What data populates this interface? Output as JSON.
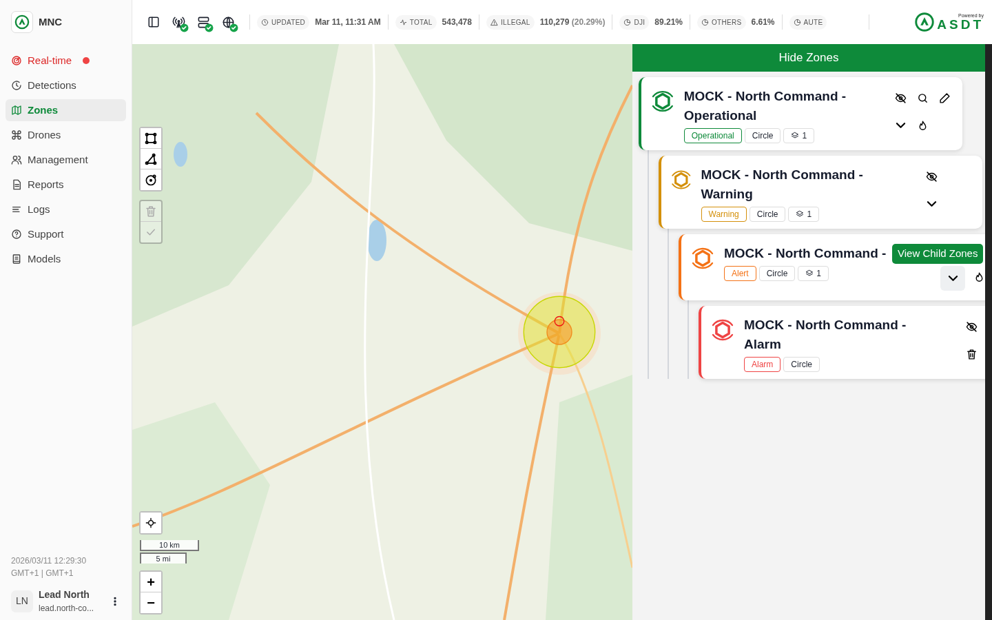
{
  "sidebar": {
    "app_name": "MNC",
    "items": [
      {
        "label": "Real-time",
        "selected": false,
        "live": true
      },
      {
        "label": "Detections",
        "selected": false,
        "live": false
      },
      {
        "label": "Zones",
        "selected": true,
        "live": false
      },
      {
        "label": "Drones",
        "selected": false,
        "live": false
      },
      {
        "label": "Management",
        "selected": false,
        "live": false
      },
      {
        "label": "Reports",
        "selected": false,
        "live": false
      },
      {
        "label": "Logs",
        "selected": false,
        "live": false
      },
      {
        "label": "Support",
        "selected": false,
        "live": false
      },
      {
        "label": "Models",
        "selected": false,
        "live": false
      }
    ],
    "datetime": "2026/03/11 12:29:30",
    "timezone": "GMT+1 | GMT+1",
    "user": {
      "initials": "LN",
      "name": "Lead North",
      "email": "lead.north-co..."
    }
  },
  "toolbar": {
    "status_icons": [
      {
        "ok": true
      },
      {
        "ok": true
      },
      {
        "ok": true
      }
    ],
    "stats": [
      {
        "label": "UPDATED",
        "value": "Mar 11, 11:31 AM"
      },
      {
        "label": "TOTAL",
        "value": "543,478"
      },
      {
        "label": "ILLEGAL",
        "value": "110,279",
        "extra": "(20.29%)"
      },
      {
        "label": "DJI",
        "value": "89.21%"
      },
      {
        "label": "OTHERS",
        "value": "6.61%"
      },
      {
        "label": "AUTE"
      }
    ],
    "powered_by": "Powered by",
    "brand": "ASDT"
  },
  "map": {
    "scale": [
      "10 km",
      "5 mi"
    ],
    "zoom_in": "+",
    "zoom_out": "−"
  },
  "zones_panel": {
    "toggle": "Hide Zones",
    "zones": [
      {
        "name": "MOCK - North Command - Operational",
        "color": "#0e8a3a",
        "status": "Operational",
        "shape": "Circle",
        "layers": "1",
        "actions": [
          {
            "kind": "hide",
            "active": false
          },
          {
            "kind": "search",
            "active": false
          },
          {
            "kind": "edit",
            "active": false
          },
          {
            "kind": "expand",
            "active": false
          },
          {
            "kind": "burn",
            "active": false
          }
        ],
        "children": [
          {
            "name": "MOCK - North Command - Warning",
            "color": "#d4900a",
            "status": "Warning",
            "shape": "Circle",
            "layers": "1",
            "actions": [
              {
                "kind": "hide",
                "active": false
              },
              {
                "kind": "expand",
                "active": false
              }
            ],
            "children": [
              {
                "name": "MOCK - North Command -",
                "color": "#f47216",
                "status": "Alert",
                "shape": "Circle",
                "layers": "1",
                "tooltip": "View Child Zones",
                "actions": [
                  {
                    "kind": "expand",
                    "active": true
                  },
                  {
                    "kind": "burn",
                    "active": false
                  }
                ],
                "children": [
                  {
                    "name": "MOCK - North Command - Alarm",
                    "color": "#ef4444",
                    "status": "Alarm",
                    "shape": "Circle",
                    "actions": [
                      {
                        "kind": "hide",
                        "active": false
                      },
                      {
                        "kind": "delete",
                        "active": false
                      }
                    ]
                  }
                ]
              }
            ]
          }
        ]
      }
    ]
  }
}
